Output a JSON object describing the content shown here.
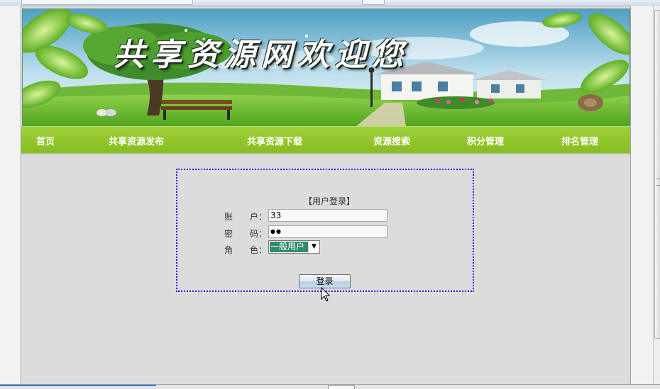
{
  "banner": {
    "title": "共享资源网欢迎您"
  },
  "nav": {
    "items": [
      {
        "label": "首页"
      },
      {
        "label": "共享资源发布"
      },
      {
        "label": "共享资源下载"
      },
      {
        "label": "资源搜索"
      },
      {
        "label": "积分管理"
      },
      {
        "label": "排名管理"
      }
    ]
  },
  "login": {
    "title": "【用户登录】",
    "account_label": "账　　户：",
    "account_value": "33",
    "password_label": "密　　码：",
    "password_value": "●●",
    "role_label": "角　　色：",
    "role_selected": "一般用户",
    "submit_label": "登录"
  },
  "icons": {
    "dropdown": "chevron-down-icon",
    "cursor": "mouse-pointer-icon"
  },
  "colors": {
    "nav_green": "#8fc42a",
    "login_border": "#1a1adf",
    "select_highlight": "#2f8a6c"
  }
}
